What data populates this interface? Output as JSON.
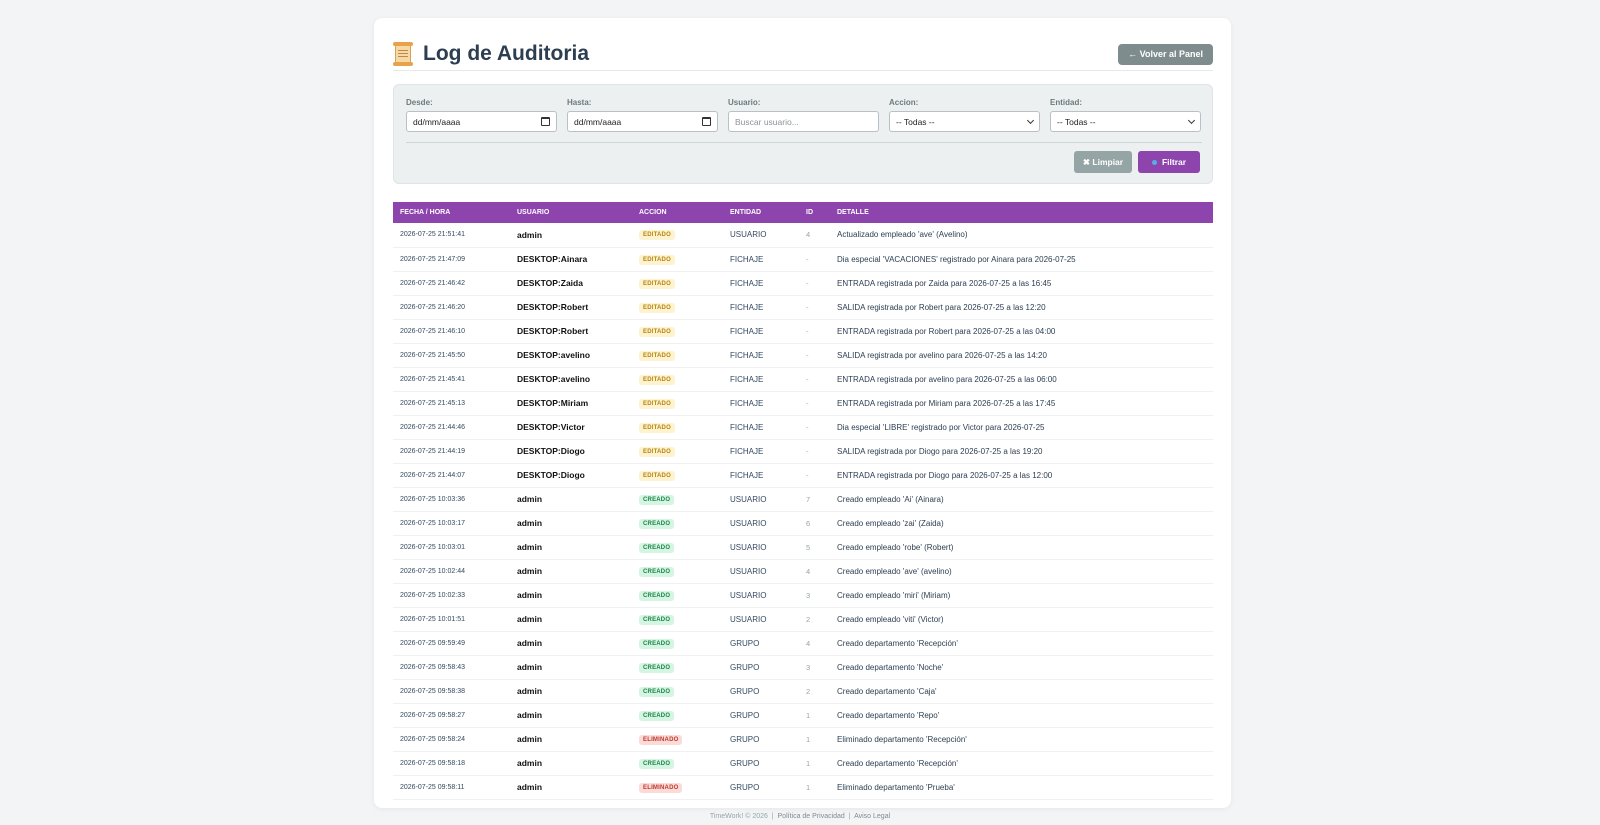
{
  "header": {
    "title": "Log de Auditoria",
    "back_label": "← Volver al Panel"
  },
  "filters": {
    "desde": {
      "label": "Desde:",
      "value": "dd/mm/aaaa"
    },
    "hasta": {
      "label": "Hasta:",
      "value": "dd/mm/aaaa"
    },
    "usuario": {
      "label": "Usuario:",
      "placeholder": "Buscar usuario..."
    },
    "accion": {
      "label": "Accion:",
      "selected": "-- Todas --"
    },
    "entidad": {
      "label": "Entidad:",
      "selected": "-- Todas --"
    },
    "clear_label": "✖ Limpiar",
    "filter_label": "Filtrar"
  },
  "table": {
    "headers": [
      "FECHA / HORA",
      "USUARIO",
      "ACCION",
      "ENTIDAD",
      "ID",
      "DETALLE"
    ],
    "rows": [
      {
        "ts": "2026-07-25 21:51:41",
        "user": "admin",
        "action": "EDITADO",
        "entity": "USUARIO",
        "id": "4",
        "detail": "Actualizado empleado 'ave' (Avelino)"
      },
      {
        "ts": "2026-07-25 21:47:09",
        "user": "DESKTOP:Ainara",
        "action": "EDITADO",
        "entity": "FICHAJE",
        "id": "-",
        "detail": "Dia especial 'VACACIONES' registrado por Ainara para 2026-07-25"
      },
      {
        "ts": "2026-07-25 21:46:42",
        "user": "DESKTOP:Zaida",
        "action": "EDITADO",
        "entity": "FICHAJE",
        "id": "-",
        "detail": "ENTRADA registrada por Zaida para 2026-07-25 a las 16:45"
      },
      {
        "ts": "2026-07-25 21:46:20",
        "user": "DESKTOP:Robert",
        "action": "EDITADO",
        "entity": "FICHAJE",
        "id": "-",
        "detail": "SALIDA registrada por Robert para 2026-07-25 a las 12:20"
      },
      {
        "ts": "2026-07-25 21:46:10",
        "user": "DESKTOP:Robert",
        "action": "EDITADO",
        "entity": "FICHAJE",
        "id": "-",
        "detail": "ENTRADA registrada por Robert para 2026-07-25 a las 04:00"
      },
      {
        "ts": "2026-07-25 21:45:50",
        "user": "DESKTOP:avelino",
        "action": "EDITADO",
        "entity": "FICHAJE",
        "id": "-",
        "detail": "SALIDA registrada por avelino para 2026-07-25 a las 14:20"
      },
      {
        "ts": "2026-07-25 21:45:41",
        "user": "DESKTOP:avelino",
        "action": "EDITADO",
        "entity": "FICHAJE",
        "id": "-",
        "detail": "ENTRADA registrada por avelino para 2026-07-25 a las 06:00"
      },
      {
        "ts": "2026-07-25 21:45:13",
        "user": "DESKTOP:Miriam",
        "action": "EDITADO",
        "entity": "FICHAJE",
        "id": "-",
        "detail": "ENTRADA registrada por Miriam para 2026-07-25 a las 17:45"
      },
      {
        "ts": "2026-07-25 21:44:46",
        "user": "DESKTOP:Victor",
        "action": "EDITADO",
        "entity": "FICHAJE",
        "id": "-",
        "detail": "Dia especial 'LIBRE' registrado por Victor para 2026-07-25"
      },
      {
        "ts": "2026-07-25 21:44:19",
        "user": "DESKTOP:Diogo",
        "action": "EDITADO",
        "entity": "FICHAJE",
        "id": "-",
        "detail": "SALIDA registrada por Diogo para 2026-07-25 a las 19:20"
      },
      {
        "ts": "2026-07-25 21:44:07",
        "user": "DESKTOP:Diogo",
        "action": "EDITADO",
        "entity": "FICHAJE",
        "id": "-",
        "detail": "ENTRADA registrada por Diogo para 2026-07-25 a las 12:00"
      },
      {
        "ts": "2026-07-25 10:03:36",
        "user": "admin",
        "action": "CREADO",
        "entity": "USUARIO",
        "id": "7",
        "detail": "Creado empleado 'Ai' (Ainara)"
      },
      {
        "ts": "2026-07-25 10:03:17",
        "user": "admin",
        "action": "CREADO",
        "entity": "USUARIO",
        "id": "6",
        "detail": "Creado empleado 'zai' (Zaida)"
      },
      {
        "ts": "2026-07-25 10:03:01",
        "user": "admin",
        "action": "CREADO",
        "entity": "USUARIO",
        "id": "5",
        "detail": "Creado empleado 'robe' (Robert)"
      },
      {
        "ts": "2026-07-25 10:02:44",
        "user": "admin",
        "action": "CREADO",
        "entity": "USUARIO",
        "id": "4",
        "detail": "Creado empleado 'ave' (avelino)"
      },
      {
        "ts": "2026-07-25 10:02:33",
        "user": "admin",
        "action": "CREADO",
        "entity": "USUARIO",
        "id": "3",
        "detail": "Creado empleado 'miri' (Miriam)"
      },
      {
        "ts": "2026-07-25 10:01:51",
        "user": "admin",
        "action": "CREADO",
        "entity": "USUARIO",
        "id": "2",
        "detail": "Creado empleado 'viti' (Victor)"
      },
      {
        "ts": "2026-07-25 09:59:49",
        "user": "admin",
        "action": "CREADO",
        "entity": "GRUPO",
        "id": "4",
        "detail": "Creado departamento 'Recepción'"
      },
      {
        "ts": "2026-07-25 09:58:43",
        "user": "admin",
        "action": "CREADO",
        "entity": "GRUPO",
        "id": "3",
        "detail": "Creado departamento 'Noche'"
      },
      {
        "ts": "2026-07-25 09:58:38",
        "user": "admin",
        "action": "CREADO",
        "entity": "GRUPO",
        "id": "2",
        "detail": "Creado departamento 'Caja'"
      },
      {
        "ts": "2026-07-25 09:58:27",
        "user": "admin",
        "action": "CREADO",
        "entity": "GRUPO",
        "id": "1",
        "detail": "Creado departamento 'Repo'"
      },
      {
        "ts": "2026-07-25 09:58:24",
        "user": "admin",
        "action": "ELIMINADO",
        "entity": "GRUPO",
        "id": "1",
        "detail": "Eliminado departamento 'Recepción'"
      },
      {
        "ts": "2026-07-25 09:58:18",
        "user": "admin",
        "action": "CREADO",
        "entity": "GRUPO",
        "id": "1",
        "detail": "Creado departamento 'Recepción'"
      },
      {
        "ts": "2026-07-25 09:58:11",
        "user": "admin",
        "action": "ELIMINADO",
        "entity": "GRUPO",
        "id": "1",
        "detail": "Eliminado departamento 'Prueba'"
      }
    ]
  },
  "badge_colors": {
    "EDITADO": {
      "bg": "#fdf3d0",
      "fg": "#b7860b"
    },
    "CREADO": {
      "bg": "#d5f5e3",
      "fg": "#1e8449"
    },
    "ELIMINADO": {
      "bg": "#fadbd8",
      "fg": "#c0392b"
    }
  },
  "colors": {
    "accent": "#8e44ad",
    "back_button": "#7f8c8d",
    "clear_button": "#95a5a6"
  },
  "footer": {
    "brand": "TimeWork! © 2026",
    "sep": "|",
    "privacy": "Política de Privacidad",
    "legal": "Aviso Legal"
  }
}
